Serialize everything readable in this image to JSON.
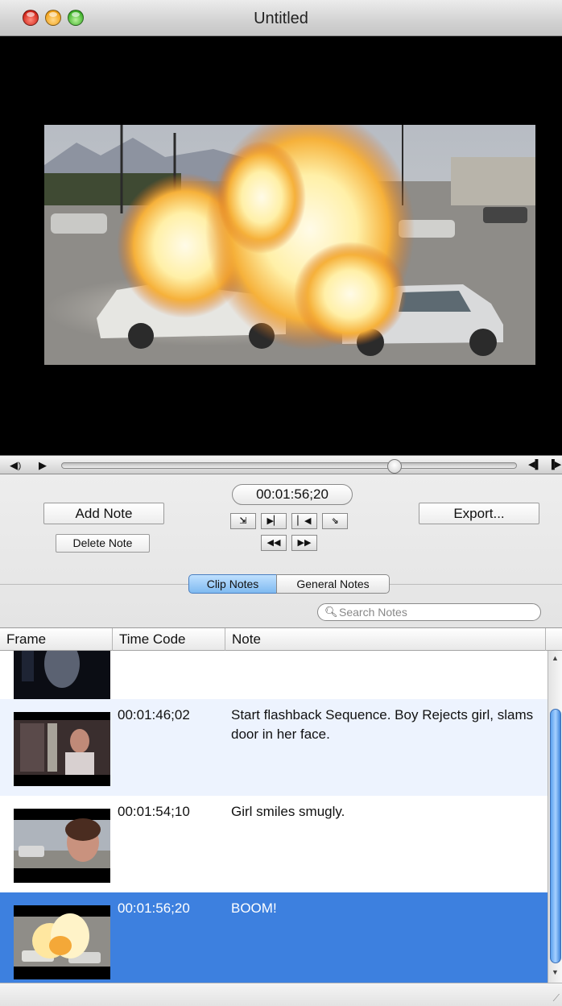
{
  "window": {
    "title": "Untitled"
  },
  "controller": {
    "volume_icon": "speaker-icon",
    "play_icon": "play-icon",
    "playhead_position": 0.74,
    "step_back_icon": "step-back-icon",
    "step_forward_icon": "step-forward-icon"
  },
  "controls": {
    "timecode": "00:01:56;20",
    "add_note_label": "Add Note",
    "delete_note_label": "Delete Note",
    "export_label": "Export...",
    "nav_buttons": [
      "mark-in",
      "play-selection",
      "go-start",
      "mark-out",
      "rewind",
      "fast-forward"
    ]
  },
  "tabs": {
    "clip_notes": "Clip Notes",
    "general_notes": "General Notes",
    "active": "clip_notes"
  },
  "search": {
    "placeholder": "Search Notes"
  },
  "table": {
    "columns": {
      "frame": "Frame",
      "time_code": "Time Code",
      "note": "Note"
    },
    "rows": [
      {
        "time_code": "",
        "note": ""
      },
      {
        "time_code": "00:01:46;02",
        "note": "Start flashback Sequence. Boy Rejects girl, slams door in her face."
      },
      {
        "time_code": "00:01:54;10",
        "note": "Girl smiles smugly."
      },
      {
        "time_code": "00:01:56;20",
        "note": "BOOM!",
        "selected": true
      }
    ]
  },
  "colors": {
    "selection": "#3d80df",
    "alternate_row": "#edf3fe",
    "segment_active": "#7fbaf0"
  }
}
